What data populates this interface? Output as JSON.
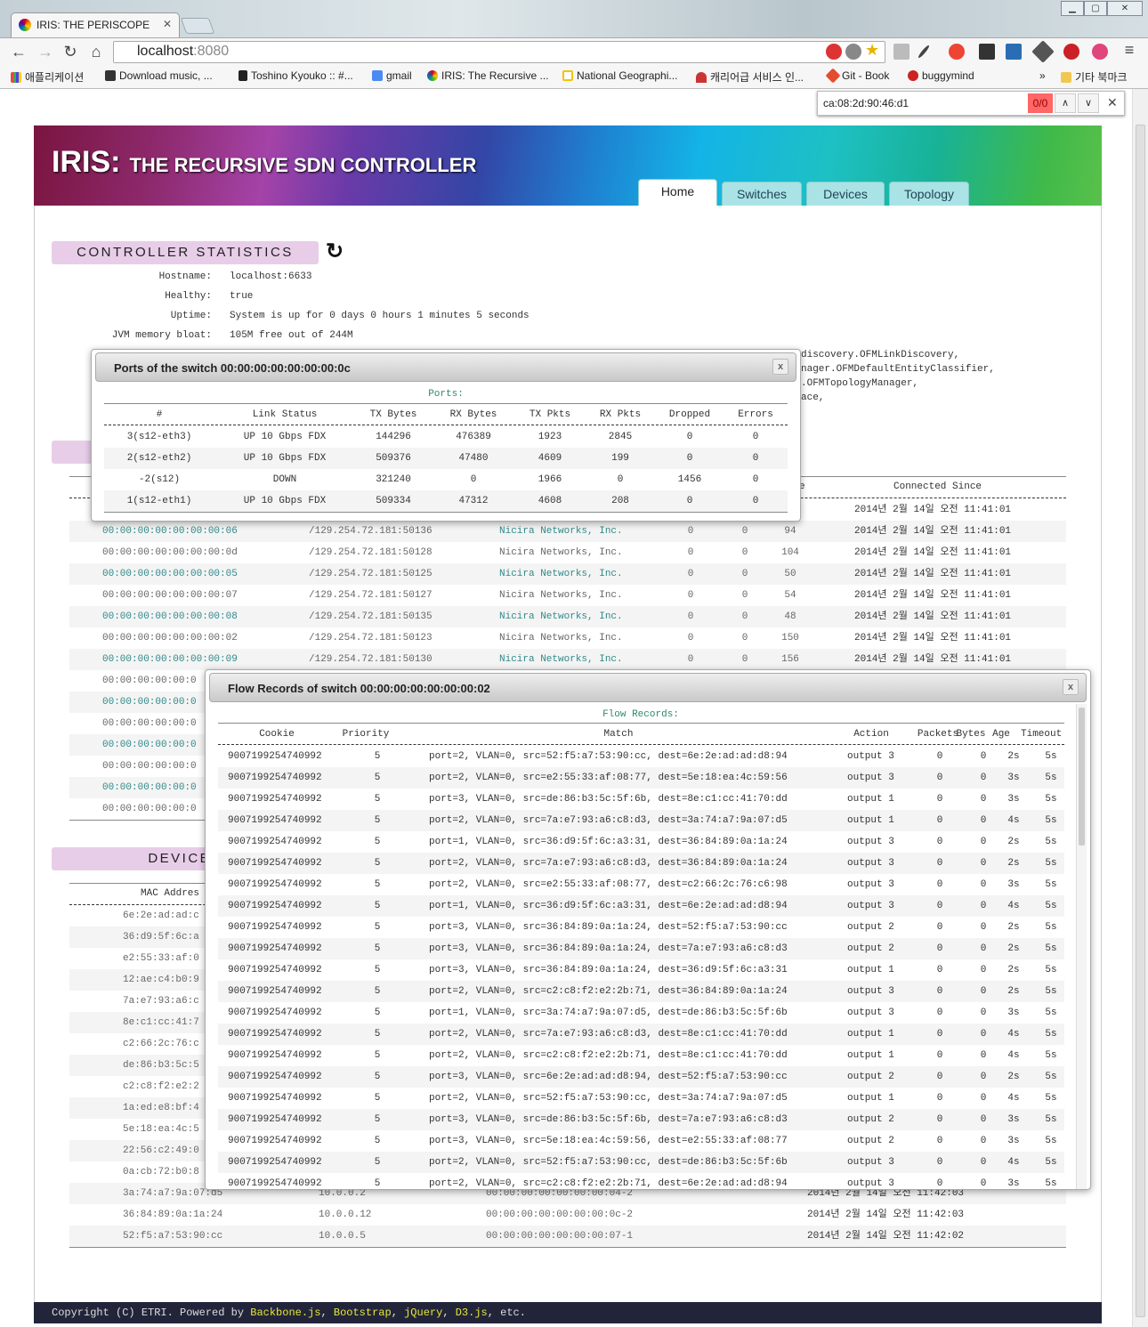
{
  "browser": {
    "tab_title": "IRIS: THE PERISCOPE",
    "url_host": "localhost",
    "url_port": ":8080",
    "bookmarks": [
      "애플리케이션",
      "Download music, ...",
      "Toshino Kyouko :: #...",
      "gmail",
      "IRIS: The Recursive ...",
      "National Geographi...",
      "캐리어급 서비스 인...",
      "Git - Book",
      "buggymind"
    ],
    "bookmarks_more": "»",
    "other_bookmarks": "기타 북마크",
    "find_query": "ca:08:2d:90:46:d1",
    "find_count": "0/0"
  },
  "header": {
    "logo_main": "IRIS:",
    "logo_sub": "THE RECURSIVE SDN CONTROLLER",
    "tabs": [
      "Home",
      "Switches",
      "Devices",
      "Topology"
    ],
    "active_tab": "Home"
  },
  "controller": {
    "title": "CONTROLLER STATISTICS",
    "stats": [
      {
        "label": "Hostname:",
        "value": "localhost:6633"
      },
      {
        "label": "Healthy:",
        "value": "true"
      },
      {
        "label": "Uptime:",
        "value": "System is up for 0 days 0 hours 1 minutes 5 seconds"
      },
      {
        "label": "JVM memory bloat:",
        "value": "105M free out of 244M"
      }
    ],
    "modules_partial": [
      "discovery.OFMLinkDiscovery,",
      "nager.OFMDefaultEntityClassifier,",
      ".OFMTopologyManager,",
      "ace,"
    ]
  },
  "switches": {
    "header_partial": "e",
    "header_connected": "Connected Since",
    "rows": [
      [
        "",
        "",
        "",
        "",
        "",
        "",
        "2014년 2월 14일 오전 11:41:01"
      ],
      [
        "00:00:00:00:00:00:00:06",
        "/129.254.72.181:50136",
        "Nicira Networks, Inc.",
        "0",
        "0",
        "94",
        "2014년 2월 14일 오전 11:41:01"
      ],
      [
        "00:00:00:00:00:00:00:0d",
        "/129.254.72.181:50128",
        "Nicira Networks, Inc.",
        "0",
        "0",
        "104",
        "2014년 2월 14일 오전 11:41:01"
      ],
      [
        "00:00:00:00:00:00:00:05",
        "/129.254.72.181:50125",
        "Nicira Networks, Inc.",
        "0",
        "0",
        "50",
        "2014년 2월 14일 오전 11:41:01"
      ],
      [
        "00:00:00:00:00:00:00:07",
        "/129.254.72.181:50127",
        "Nicira Networks, Inc.",
        "0",
        "0",
        "54",
        "2014년 2월 14일 오전 11:41:01"
      ],
      [
        "00:00:00:00:00:00:00:08",
        "/129.254.72.181:50135",
        "Nicira Networks, Inc.",
        "0",
        "0",
        "48",
        "2014년 2월 14일 오전 11:41:01"
      ],
      [
        "00:00:00:00:00:00:00:02",
        "/129.254.72.181:50123",
        "Nicira Networks, Inc.",
        "0",
        "0",
        "150",
        "2014년 2월 14일 오전 11:41:01"
      ],
      [
        "00:00:00:00:00:00:00:09",
        "/129.254.72.181:50130",
        "Nicira Networks, Inc.",
        "0",
        "0",
        "156",
        "2014년 2월 14일 오전 11:41:01"
      ],
      [
        "00:00:00:00:00:0",
        "",
        "",
        "",
        "",
        "",
        ""
      ],
      [
        "00:00:00:00:00:0",
        "",
        "",
        "",
        "",
        "",
        ""
      ],
      [
        "00:00:00:00:00:0",
        "",
        "",
        "",
        "",
        "",
        ""
      ],
      [
        "00:00:00:00:00:0",
        "",
        "",
        "",
        "",
        "",
        ""
      ],
      [
        "00:00:00:00:00:0",
        "",
        "",
        "",
        "",
        "",
        ""
      ],
      [
        "00:00:00:00:00:0",
        "",
        "",
        "",
        "",
        "",
        ""
      ],
      [
        "00:00:00:00:00:0",
        "",
        "",
        "",
        "",
        "",
        ""
      ]
    ]
  },
  "devices": {
    "title": "DEVICES",
    "header_mac": "MAC Addres",
    "rows": [
      [
        "6e:2e:ad:ad:c",
        "",
        "",
        ""
      ],
      [
        "36:d9:5f:6c:a",
        "",
        "",
        ""
      ],
      [
        "e2:55:33:af:0",
        "",
        "",
        ""
      ],
      [
        "12:ae:c4:b0:9",
        "",
        "",
        ""
      ],
      [
        "7a:e7:93:a6:c",
        "",
        "",
        ""
      ],
      [
        "8e:c1:cc:41:7",
        "",
        "",
        ""
      ],
      [
        "c2:66:2c:76:c",
        "",
        "",
        ""
      ],
      [
        "de:86:b3:5c:5",
        "",
        "",
        ""
      ],
      [
        "c2:c8:f2:e2:2",
        "",
        "",
        ""
      ],
      [
        "1a:ed:e8:bf:4",
        "",
        "",
        ""
      ],
      [
        "5e:18:ea:4c:5",
        "",
        "",
        ""
      ],
      [
        "22:56:c2:49:0",
        "",
        "",
        ""
      ],
      [
        "0a:cb:72:b0:8",
        "",
        "",
        ""
      ],
      [
        "3a:74:a7:9a:07:d5",
        "10.0.0.2",
        "00:00:00:00:00:00:00:04-2",
        "2014년 2월 14일 오전 11:42:03"
      ],
      [
        "36:84:89:0a:1a:24",
        "10.0.0.12",
        "00:00:00:00:00:00:00:0c-2",
        "2014년 2월 14일 오전 11:42:03"
      ],
      [
        "52:f5:a7:53:90:cc",
        "10.0.0.5",
        "00:00:00:00:00:00:00:07-1",
        "2014년 2월 14일 오전 11:42:02"
      ]
    ]
  },
  "ports_modal": {
    "title": "Ports of the switch 00:00:00:00:00:00:00:0c",
    "close": "x",
    "caption": "Ports:",
    "columns": [
      "#",
      "Link Status",
      "TX Bytes",
      "RX Bytes",
      "TX Pkts",
      "RX Pkts",
      "Dropped",
      "Errors"
    ],
    "rows": [
      [
        "3(s12-eth3)",
        "UP 10 Gbps FDX",
        "144296",
        "476389",
        "1923",
        "2845",
        "0",
        "0"
      ],
      [
        "2(s12-eth2)",
        "UP 10 Gbps FDX",
        "509376",
        "47480",
        "4609",
        "199",
        "0",
        "0"
      ],
      [
        "-2(s12)",
        "DOWN",
        "321240",
        "0",
        "1966",
        "0",
        "1456",
        "0"
      ],
      [
        "1(s12-eth1)",
        "UP 10 Gbps FDX",
        "509334",
        "47312",
        "4608",
        "208",
        "0",
        "0"
      ]
    ]
  },
  "flow_modal": {
    "title": "Flow Records of switch 00:00:00:00:00:00:00:02",
    "close": "x",
    "caption": "Flow Records:",
    "columns": [
      "Cookie",
      "Priority",
      "Match",
      "Action",
      "Packets",
      "Bytes",
      "Age",
      "Timeout"
    ],
    "rows": [
      [
        "9007199254740992",
        "5",
        "port=2, VLAN=0, src=52:f5:a7:53:90:cc, dest=6e:2e:ad:ad:d8:94",
        "output 3",
        "0",
        "0",
        "2s",
        "5s"
      ],
      [
        "9007199254740992",
        "5",
        "port=2, VLAN=0, src=e2:55:33:af:08:77, dest=5e:18:ea:4c:59:56",
        "output 3",
        "0",
        "0",
        "3s",
        "5s"
      ],
      [
        "9007199254740992",
        "5",
        "port=3, VLAN=0, src=de:86:b3:5c:5f:6b, dest=8e:c1:cc:41:70:dd",
        "output 1",
        "0",
        "0",
        "3s",
        "5s"
      ],
      [
        "9007199254740992",
        "5",
        "port=2, VLAN=0, src=7a:e7:93:a6:c8:d3, dest=3a:74:a7:9a:07:d5",
        "output 1",
        "0",
        "0",
        "4s",
        "5s"
      ],
      [
        "9007199254740992",
        "5",
        "port=1, VLAN=0, src=36:d9:5f:6c:a3:31, dest=36:84:89:0a:1a:24",
        "output 3",
        "0",
        "0",
        "2s",
        "5s"
      ],
      [
        "9007199254740992",
        "5",
        "port=2, VLAN=0, src=7a:e7:93:a6:c8:d3, dest=36:84:89:0a:1a:24",
        "output 3",
        "0",
        "0",
        "2s",
        "5s"
      ],
      [
        "9007199254740992",
        "5",
        "port=2, VLAN=0, src=e2:55:33:af:08:77, dest=c2:66:2c:76:c6:98",
        "output 3",
        "0",
        "0",
        "3s",
        "5s"
      ],
      [
        "9007199254740992",
        "5",
        "port=1, VLAN=0, src=36:d9:5f:6c:a3:31, dest=6e:2e:ad:ad:d8:94",
        "output 3",
        "0",
        "0",
        "4s",
        "5s"
      ],
      [
        "9007199254740992",
        "5",
        "port=3, VLAN=0, src=36:84:89:0a:1a:24, dest=52:f5:a7:53:90:cc",
        "output 2",
        "0",
        "0",
        "2s",
        "5s"
      ],
      [
        "9007199254740992",
        "5",
        "port=3, VLAN=0, src=36:84:89:0a:1a:24, dest=7a:e7:93:a6:c8:d3",
        "output 2",
        "0",
        "0",
        "2s",
        "5s"
      ],
      [
        "9007199254740992",
        "5",
        "port=3, VLAN=0, src=36:84:89:0a:1a:24, dest=36:d9:5f:6c:a3:31",
        "output 1",
        "0",
        "0",
        "2s",
        "5s"
      ],
      [
        "9007199254740992",
        "5",
        "port=2, VLAN=0, src=c2:c8:f2:e2:2b:71, dest=36:84:89:0a:1a:24",
        "output 3",
        "0",
        "0",
        "2s",
        "5s"
      ],
      [
        "9007199254740992",
        "5",
        "port=1, VLAN=0, src=3a:74:a7:9a:07:d5, dest=de:86:b3:5c:5f:6b",
        "output 3",
        "0",
        "0",
        "3s",
        "5s"
      ],
      [
        "9007199254740992",
        "5",
        "port=2, VLAN=0, src=7a:e7:93:a6:c8:d3, dest=8e:c1:cc:41:70:dd",
        "output 1",
        "0",
        "0",
        "4s",
        "5s"
      ],
      [
        "9007199254740992",
        "5",
        "port=2, VLAN=0, src=c2:c8:f2:e2:2b:71, dest=8e:c1:cc:41:70:dd",
        "output 1",
        "0",
        "0",
        "4s",
        "5s"
      ],
      [
        "9007199254740992",
        "5",
        "port=3, VLAN=0, src=6e:2e:ad:ad:d8:94, dest=52:f5:a7:53:90:cc",
        "output 2",
        "0",
        "0",
        "2s",
        "5s"
      ],
      [
        "9007199254740992",
        "5",
        "port=2, VLAN=0, src=52:f5:a7:53:90:cc, dest=3a:74:a7:9a:07:d5",
        "output 1",
        "0",
        "0",
        "4s",
        "5s"
      ],
      [
        "9007199254740992",
        "5",
        "port=3, VLAN=0, src=de:86:b3:5c:5f:6b, dest=7a:e7:93:a6:c8:d3",
        "output 2",
        "0",
        "0",
        "3s",
        "5s"
      ],
      [
        "9007199254740992",
        "5",
        "port=3, VLAN=0, src=5e:18:ea:4c:59:56, dest=e2:55:33:af:08:77",
        "output 2",
        "0",
        "0",
        "3s",
        "5s"
      ],
      [
        "9007199254740992",
        "5",
        "port=2, VLAN=0, src=52:f5:a7:53:90:cc, dest=de:86:b3:5c:5f:6b",
        "output 3",
        "0",
        "0",
        "4s",
        "5s"
      ],
      [
        "9007199254740992",
        "5",
        "port=2, VLAN=0, src=c2:c8:f2:e2:2b:71, dest=6e:2e:ad:ad:d8:94",
        "output 3",
        "0",
        "0",
        "3s",
        "5s"
      ]
    ]
  },
  "footer": {
    "prefix": "Copyright (C) ETRI. Powered by ",
    "links": [
      "Backbone.js",
      "Bootstrap",
      "jQuery",
      "D3.js"
    ],
    "sep": ", ",
    "suffix": ", etc."
  }
}
